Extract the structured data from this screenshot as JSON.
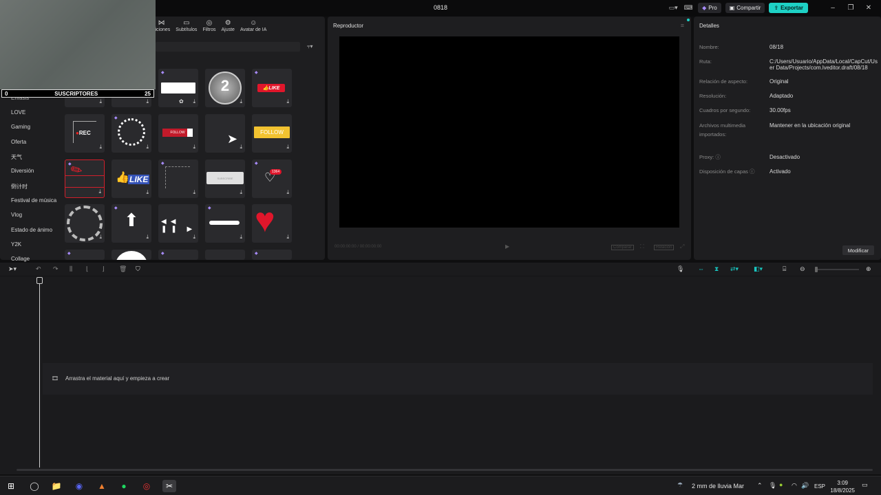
{
  "titlebar": {
    "project": "0818",
    "pro_label": "Pro",
    "share_label": "Compartir",
    "export_label": "Exportar",
    "minimize": "–",
    "restore": "❐",
    "close": "✕"
  },
  "media_tabs": [
    {
      "label": "siciones",
      "icon": "⋈"
    },
    {
      "label": "Subtítulos",
      "icon": "▭"
    },
    {
      "label": "Filtros",
      "icon": "◎"
    },
    {
      "label": "Ajuste",
      "icon": "⚙"
    },
    {
      "label": "Avatar de IA",
      "icon": "☺"
    }
  ],
  "webcam_overlay": {
    "left_value": "0",
    "title": "SUSCRIPTORES",
    "right_value": "25"
  },
  "categories": [
    "Énfasis",
    "LOVE",
    "Gaming",
    "Oferta",
    "天气",
    "Diversión",
    "倒计时",
    "Festival de música",
    "Vlog",
    "Estado de ánimo",
    "Y2K",
    "Collage"
  ],
  "tiles": {
    "rec_label": "REC",
    "follow_small": "FOLLOW",
    "follow_big": "FOLLOW",
    "like_small": "LIKE",
    "like_big": "LIKE",
    "countdown": "2",
    "badge_count": "1364",
    "subscribe_label": "SUBSCRIBE"
  },
  "player": {
    "title": "Reproductor",
    "time_left": "00:00:00:00 / 00:00:00:00",
    "compare": "Comparar",
    "ratio": "Relación"
  },
  "details": {
    "title": "Detalles",
    "rows": [
      {
        "key": "Nombre:",
        "value": "08/18"
      },
      {
        "key": "Ruta:",
        "value": "C:/Users/Usuario/AppData/Local/CapCut/User Data/Projects/com.lveditor.draft/08/18"
      },
      {
        "key": "Relación de aspecto:",
        "value": "Original"
      },
      {
        "key": "Resolución:",
        "value": "Adaptado"
      },
      {
        "key": "Cuadros por segundo:",
        "value": "30.00fps"
      },
      {
        "key": "Archivos multimedia importados:",
        "value": "Mantener en la ubicación original"
      },
      {
        "key": "Proxy: ⓘ",
        "value": "Desactivado"
      },
      {
        "key": "Disposición de capas ⓘ",
        "value": "Activado"
      }
    ],
    "modify_label": "Modificar"
  },
  "timeline": {
    "empty_hint": "Arrastra el material aquí y empieza a crear"
  },
  "taskbar": {
    "weather": "2 mm de lluvia Mar",
    "lang": "ESP",
    "time": "3:09",
    "date": "18/8/2025"
  }
}
